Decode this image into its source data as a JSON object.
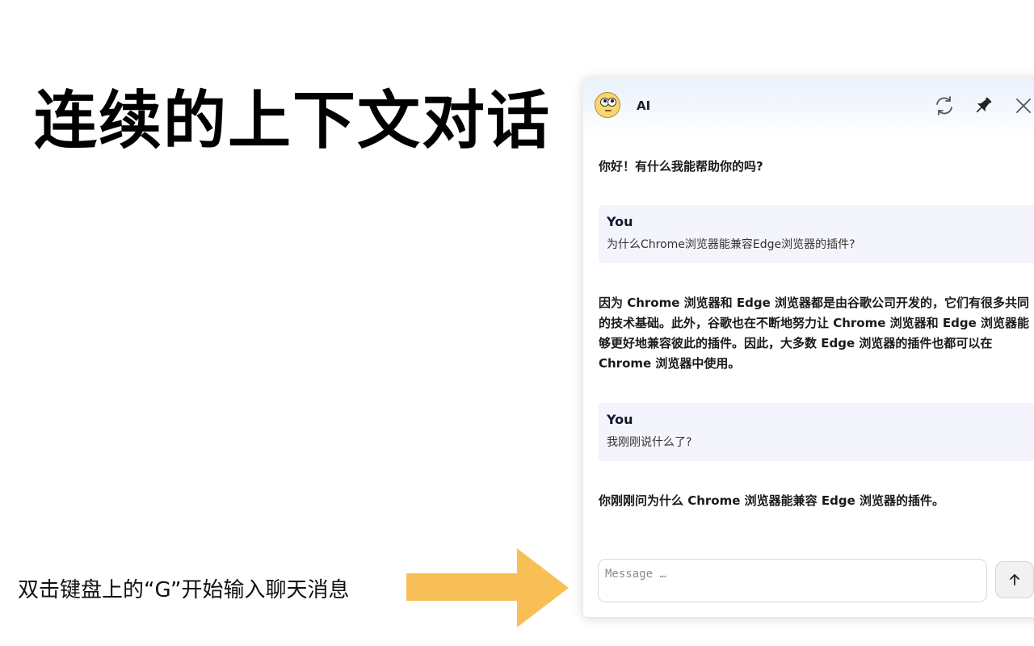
{
  "slide": {
    "headline": "连续的上下文对话",
    "hint": "双击键盘上的“G”开始输入聊天消息"
  },
  "chat": {
    "bot_name": "AI",
    "avatar_icon": "face-with-rolling-eyes-icon",
    "header_icons": [
      "refresh-icon",
      "pin-icon",
      "close-icon"
    ],
    "messages": [
      {
        "role": "ai",
        "text": "你好！有什么我能帮助你的吗?"
      },
      {
        "role": "user",
        "label": "You",
        "text": "为什么Chrome浏览器能兼容Edge浏览器的插件?"
      },
      {
        "role": "ai",
        "text": "因为 Chrome 浏览器和 Edge 浏览器都是由谷歌公司开发的，它们有很多共同的技术基础。此外，谷歌也在不断地努力让 Chrome 浏览器和 Edge 浏览器能够更好地兼容彼此的插件。因此，大多数 Edge 浏览器的插件也都可以在 Chrome 浏览器中使用。"
      },
      {
        "role": "user",
        "label": "You",
        "text": "我刚刚说什么了?"
      },
      {
        "role": "ai",
        "text": "你刚刚问为什么 Chrome 浏览器能兼容 Edge 浏览器的插件。"
      }
    ],
    "input": {
      "placeholder": "Message …",
      "value": ""
    },
    "send_icon": "arrow-up-icon"
  },
  "colors": {
    "arrow": "#f9bf57",
    "user_bubble": "#f4f5fc",
    "header_tint": "#e9f1fb"
  }
}
